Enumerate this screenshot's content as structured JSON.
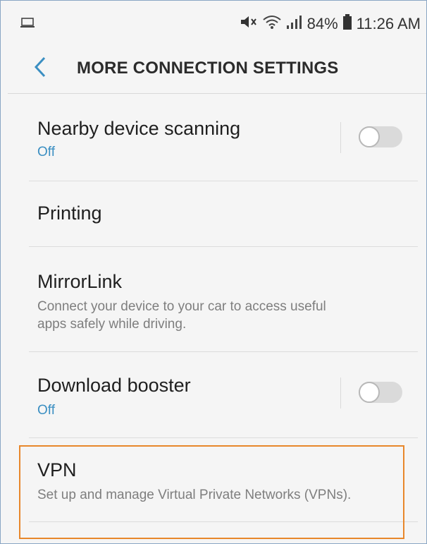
{
  "status_bar": {
    "left_icon": "laptop-icon",
    "mute_icon": "mute-icon",
    "wifi_icon": "wifi-icon",
    "signal_icon": "signal-icon",
    "battery_percent": "84%",
    "battery_icon": "battery-icon",
    "time": "11:26 AM"
  },
  "header": {
    "back_icon": "chevron-left-icon",
    "title": "MORE CONNECTION SETTINGS"
  },
  "items": [
    {
      "title": "Nearby device scanning",
      "subtitle": "Off",
      "toggle": false
    },
    {
      "title": "Printing"
    },
    {
      "title": "MirrorLink",
      "subtitle_lines": [
        "Connect your device to your car to access useful",
        "apps safely while driving."
      ]
    },
    {
      "title": "Download booster",
      "subtitle": "Off",
      "toggle": false
    },
    {
      "title": "VPN",
      "subtitle": "Set up and manage Virtual Private Networks (VPNs)."
    }
  ],
  "colors": {
    "accent": "#3b8fc2",
    "highlight_border": "#e8872b",
    "background": "#f5f5f5"
  }
}
